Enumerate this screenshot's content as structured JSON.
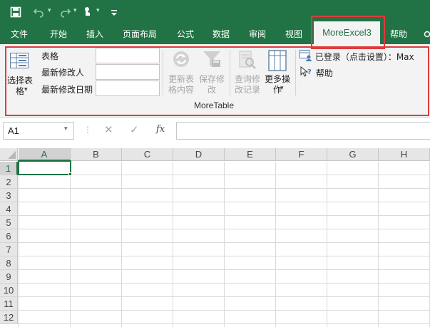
{
  "ribbon_tabs": [
    {
      "label": "文件"
    },
    {
      "label": "开始"
    },
    {
      "label": "插入"
    },
    {
      "label": "页面布局"
    },
    {
      "label": "公式"
    },
    {
      "label": "数据"
    },
    {
      "label": "审阅"
    },
    {
      "label": "视图"
    },
    {
      "label": "MoreExcel3",
      "active": true
    },
    {
      "label": "帮助"
    }
  ],
  "quick_access": {
    "icons": [
      "save-icon",
      "undo-icon",
      "redo-icon",
      "touch-mode-icon",
      "customize-icon"
    ]
  },
  "moretable": {
    "select_table_label": "选择表格",
    "fields": [
      {
        "label": "表格",
        "value": ""
      },
      {
        "label": "最新修改人",
        "value": ""
      },
      {
        "label": "最新修改日期",
        "value": ""
      }
    ],
    "update_label": "更新表格内容",
    "save_label": "保存修改",
    "query_label": "查询修改记录",
    "more_label": "更多操作",
    "login_label": "已登录（点击设置）：Max",
    "help_label": "帮助",
    "group_name": "MoreTable"
  },
  "formula_bar": {
    "name_box": "A1",
    "formula": "",
    "fx_label": "fx"
  },
  "grid": {
    "columns": [
      "A",
      "B",
      "C",
      "D",
      "E",
      "F",
      "G",
      "H"
    ],
    "rows": [
      "1",
      "2",
      "3",
      "4",
      "5",
      "6",
      "7",
      "8",
      "9",
      "10",
      "11",
      "12"
    ],
    "selected_cell": "A1"
  },
  "colors": {
    "accent": "#217346",
    "highlight": "#e03a3a"
  }
}
